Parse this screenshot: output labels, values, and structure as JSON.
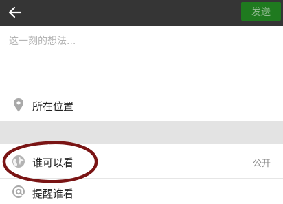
{
  "topbar": {
    "back_icon": "back-arrow-icon",
    "send_label": "发送"
  },
  "compose": {
    "placeholder": "这一刻的想法...",
    "value": ""
  },
  "location": {
    "icon": "location-pin-icon",
    "label": "所在位置"
  },
  "visibility": {
    "icon": "globe-icon",
    "label": "谁可以看",
    "value": "公开"
  },
  "remind": {
    "icon": "at-icon",
    "label": "提醒谁看"
  },
  "colors": {
    "topbar_bg": "#353535",
    "send_bg": "#1f7a1f",
    "send_text": "#8fb98f",
    "separator": "#e3e3e3",
    "annotation": "#7a1414"
  }
}
